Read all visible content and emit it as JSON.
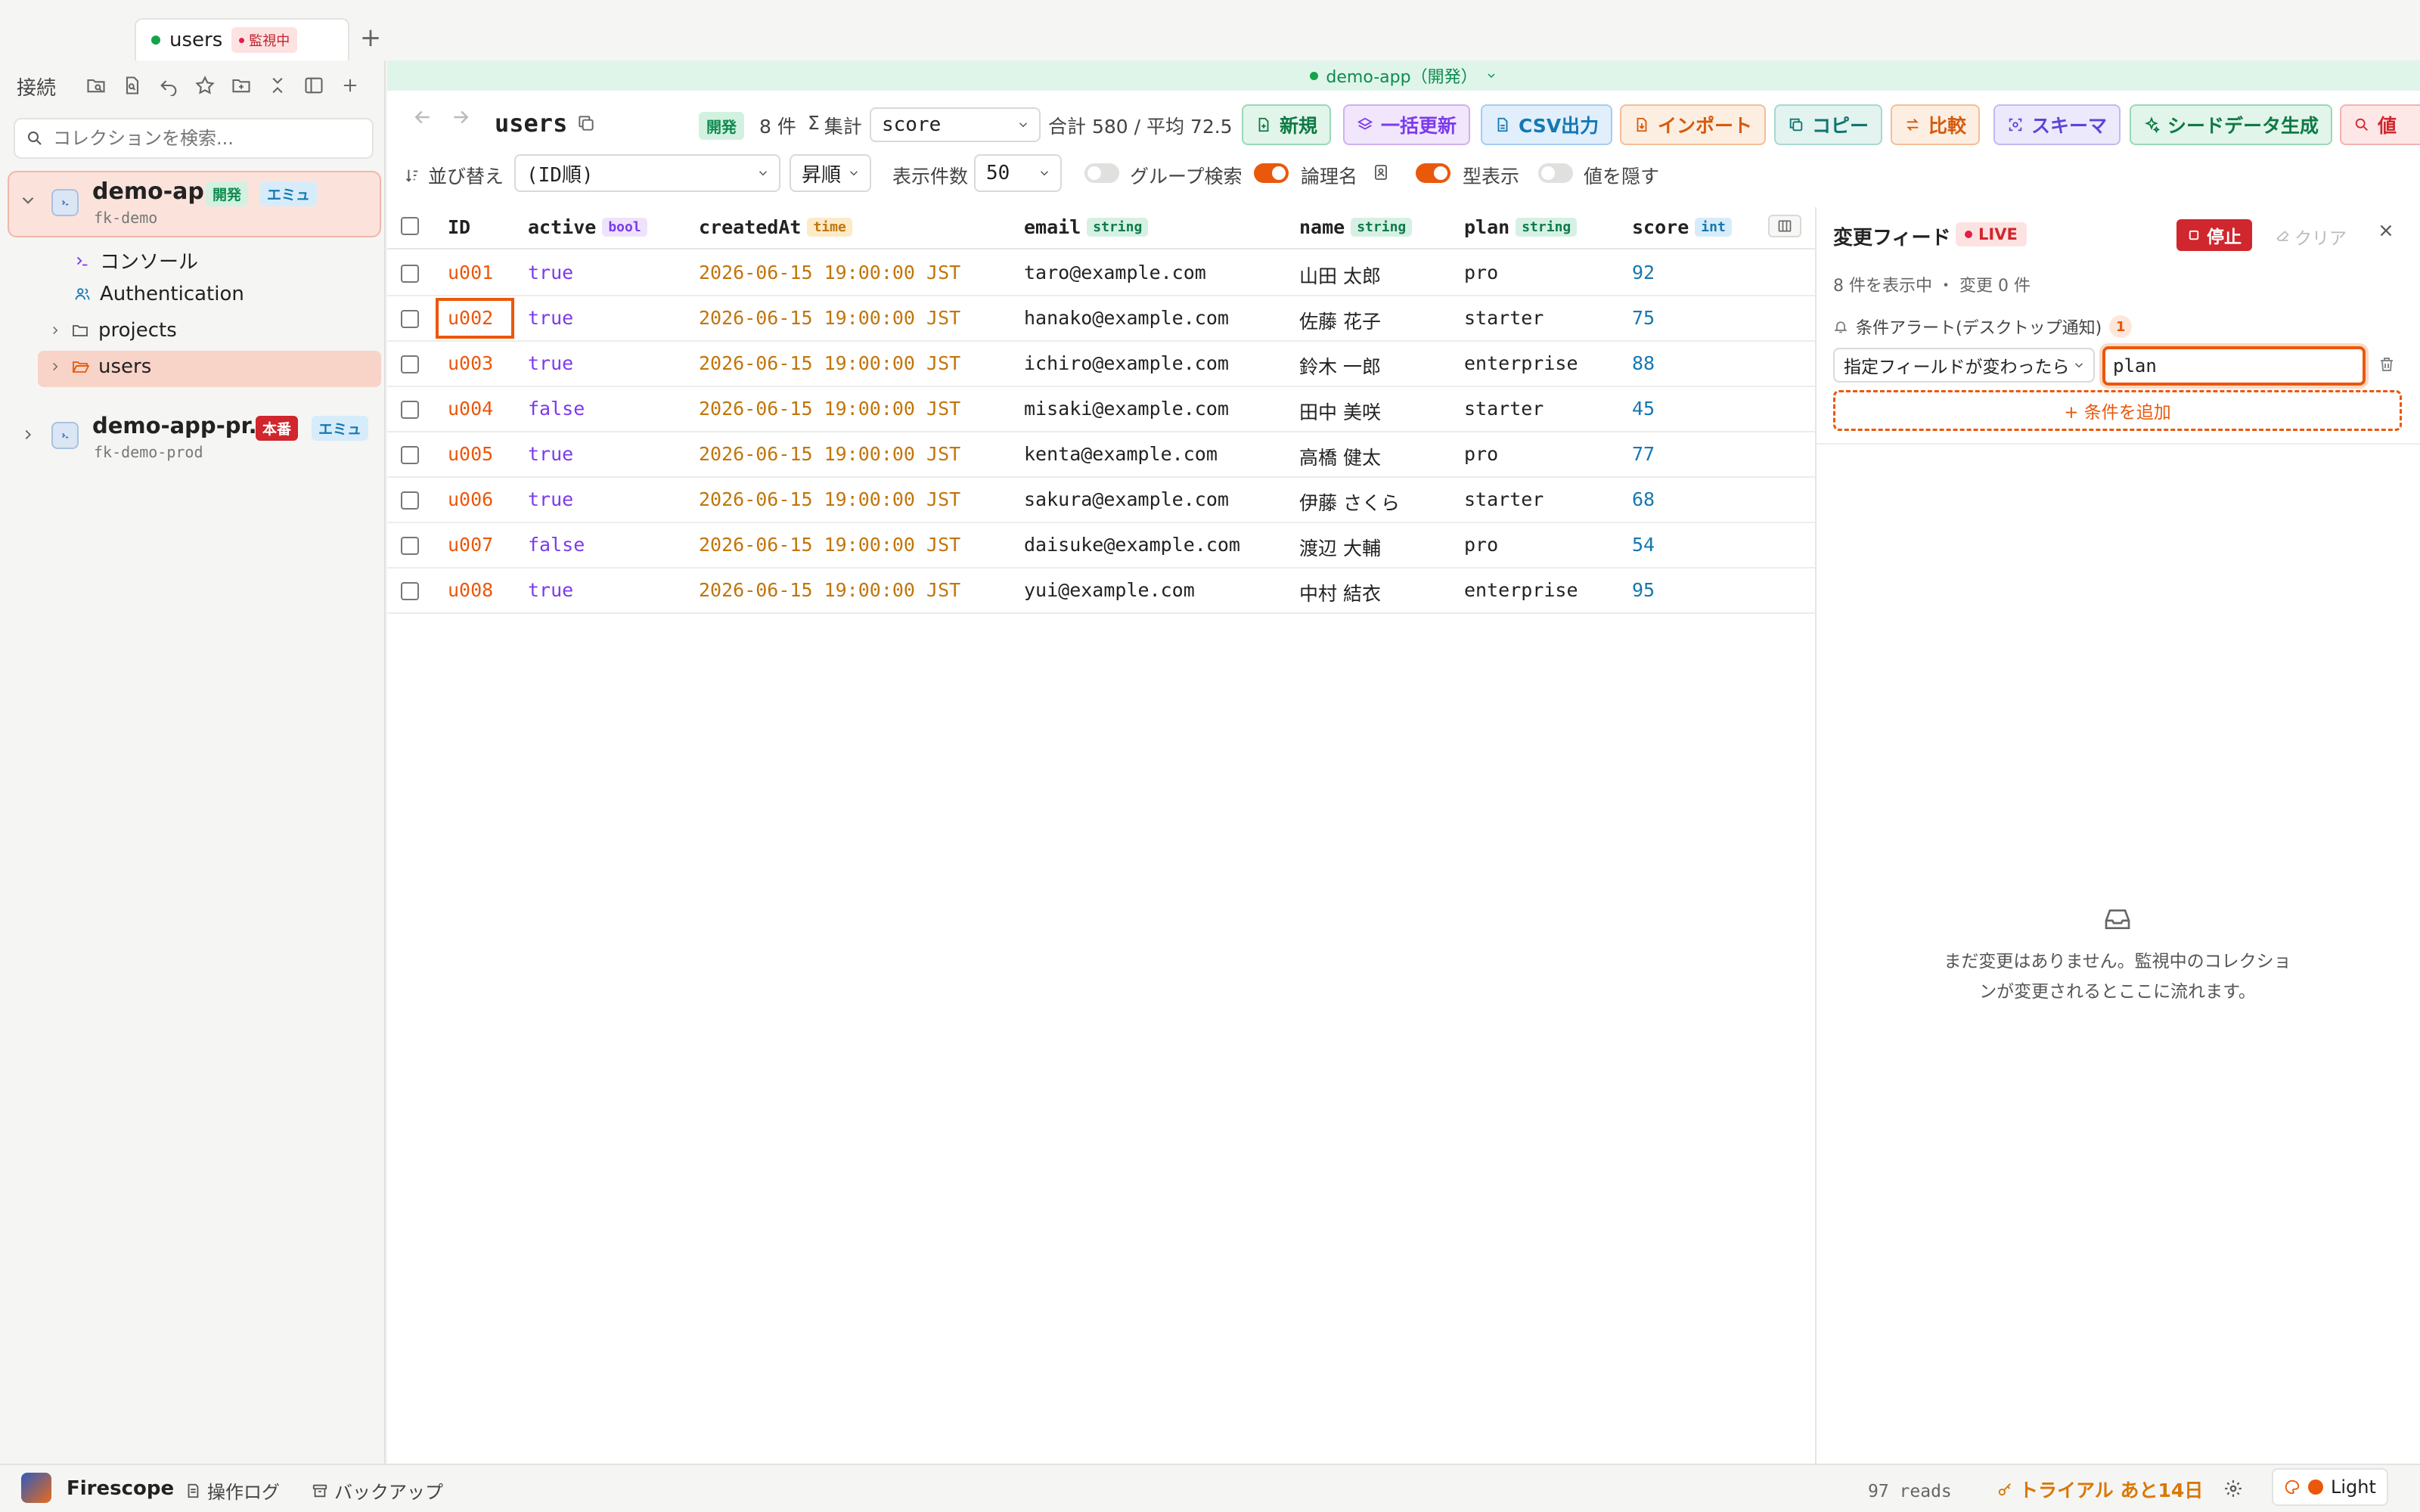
{
  "tab": {
    "name": "users",
    "watch_label": "監視中"
  },
  "sidebar": {
    "heading": "接続",
    "search_placeholder": "コレクションを検索...",
    "connections": [
      {
        "name": "demo-app",
        "badge_env": "開発",
        "badge_mode": "エミュ",
        "sub": "fk-demo"
      },
      {
        "name": "demo-app-pr...",
        "badge_env": "本番",
        "badge_mode": "エミュ",
        "sub": "fk-demo-prod"
      }
    ],
    "tree": {
      "console": "コンソール",
      "auth": "Authentication",
      "projects": "projects",
      "users": "users"
    }
  },
  "env_bar": {
    "label": "demo-app（開発）"
  },
  "toolbar": {
    "title": "users",
    "env_badge": "開発",
    "count": "8 件",
    "agg_label": "集計",
    "agg_field": "score",
    "agg_summary": "合計 580 / 平均 72.5",
    "buttons": {
      "new": "新規",
      "bulk": "一括更新",
      "csv": "CSV出力",
      "import": "インポート",
      "copy": "コピー",
      "compare": "比較",
      "schema": "スキーマ",
      "seed": "シードデータ生成",
      "more": "値"
    },
    "sort_label": "並び替え",
    "sort_field": "(ID順)",
    "sort_order": "昇順",
    "limit_label": "表示件数",
    "limit_value": "50",
    "group_search": "グループ検索",
    "logical_name": "論理名",
    "show_types": "型表示",
    "hide_values": "値を隠す"
  },
  "table": {
    "columns": [
      {
        "name": "ID",
        "type": ""
      },
      {
        "name": "active",
        "type": "bool"
      },
      {
        "name": "createdAt",
        "type": "time"
      },
      {
        "name": "email",
        "type": "string"
      },
      {
        "name": "name",
        "type": "string"
      },
      {
        "name": "plan",
        "type": "string"
      },
      {
        "name": "score",
        "type": "int"
      }
    ],
    "rows": [
      {
        "id": "u001",
        "active": "true",
        "createdAt": "2026-06-15 19:00:00 JST",
        "email": "taro@example.com",
        "name": "山田 太郎",
        "plan": "pro",
        "score": "92"
      },
      {
        "id": "u002",
        "active": "true",
        "createdAt": "2026-06-15 19:00:00 JST",
        "email": "hanako@example.com",
        "name": "佐藤 花子",
        "plan": "starter",
        "score": "75"
      },
      {
        "id": "u003",
        "active": "true",
        "createdAt": "2026-06-15 19:00:00 JST",
        "email": "ichiro@example.com",
        "name": "鈴木 一郎",
        "plan": "enterprise",
        "score": "88"
      },
      {
        "id": "u004",
        "active": "false",
        "createdAt": "2026-06-15 19:00:00 JST",
        "email": "misaki@example.com",
        "name": "田中 美咲",
        "plan": "starter",
        "score": "45"
      },
      {
        "id": "u005",
        "active": "true",
        "createdAt": "2026-06-15 19:00:00 JST",
        "email": "kenta@example.com",
        "name": "高橋 健太",
        "plan": "pro",
        "score": "77"
      },
      {
        "id": "u006",
        "active": "true",
        "createdAt": "2026-06-15 19:00:00 JST",
        "email": "sakura@example.com",
        "name": "伊藤 さくら",
        "plan": "starter",
        "score": "68"
      },
      {
        "id": "u007",
        "active": "false",
        "createdAt": "2026-06-15 19:00:00 JST",
        "email": "daisuke@example.com",
        "name": "渡辺 大輔",
        "plan": "pro",
        "score": "54"
      },
      {
        "id": "u008",
        "active": "true",
        "createdAt": "2026-06-15 19:00:00 JST",
        "email": "yui@example.com",
        "name": "中村 結衣",
        "plan": "enterprise",
        "score": "95"
      }
    ]
  },
  "feed": {
    "title": "変更フィード",
    "live": "LIVE",
    "stop": "停止",
    "clear": "クリア",
    "info": "8 件を表示中 ・ 変更 0 件",
    "alert_label": "条件アラート(デスクトップ通知)",
    "alert_count": "1",
    "condition_type": "指定フィールドが変わったら",
    "condition_field": "plan",
    "add_condition": "+ 条件を追加",
    "empty_message": "まだ変更はありません。監視中のコレクションが変更されるとここに流れます。"
  },
  "statusbar": {
    "app": "Firescope",
    "log": "操作ログ",
    "backup": "バックアップ",
    "reads": "97 reads",
    "trial": "トライアル あと14日",
    "theme": "Light"
  },
  "colors": {
    "accent": "#ea580c",
    "env_green": "#16a34a",
    "danger": "#d0262d"
  }
}
